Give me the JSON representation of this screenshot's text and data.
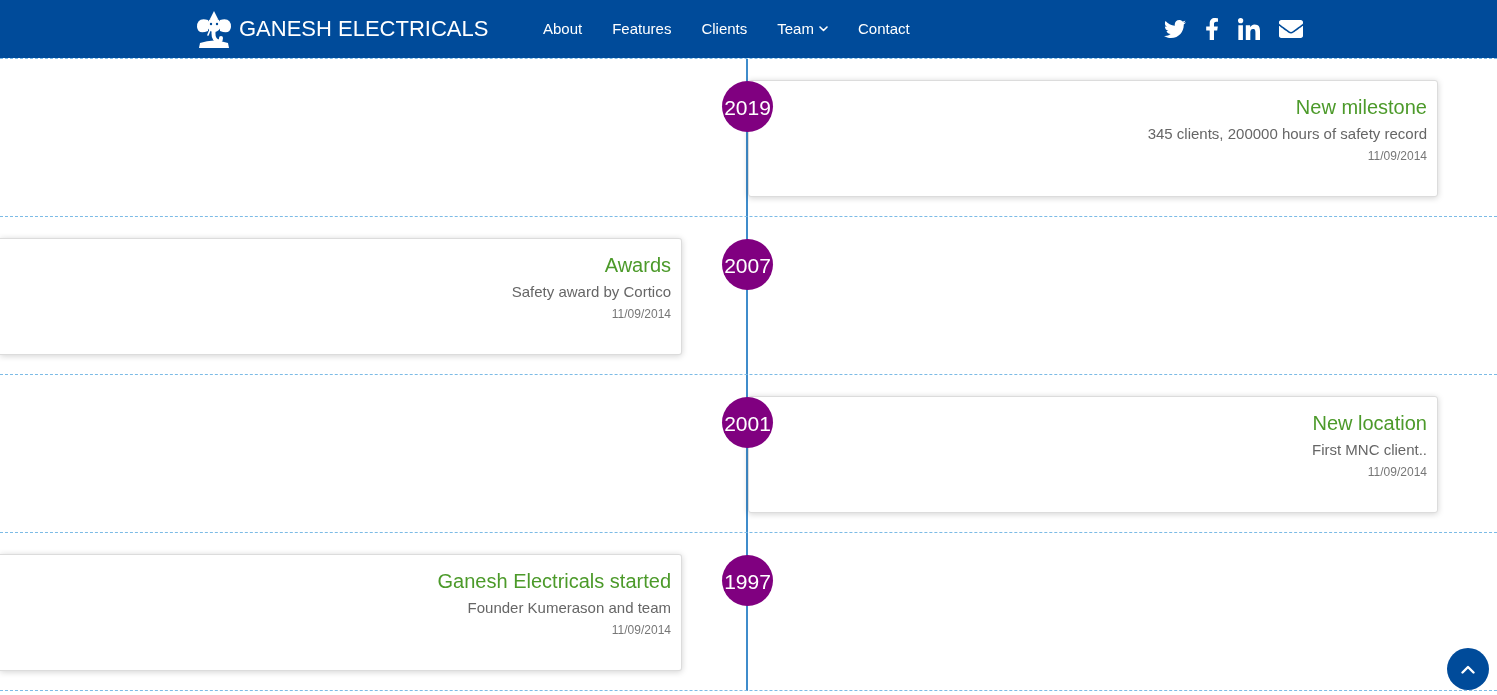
{
  "header": {
    "brand": "GANESH ELECTRICALS",
    "nav": [
      {
        "label": "About",
        "kind": "link"
      },
      {
        "label": "Features",
        "kind": "link"
      },
      {
        "label": "Clients",
        "kind": "link"
      },
      {
        "label": "Team",
        "kind": "dropdown"
      },
      {
        "label": "Contact",
        "kind": "link"
      }
    ]
  },
  "timeline": [
    {
      "year": "2019",
      "kind": "right",
      "title": "New milestone",
      "description": "345 clients, 200000 hours of safety record",
      "date": "11/09/2014"
    },
    {
      "year": "2007",
      "kind": "left",
      "title": "Awards",
      "description": "Safety award by Cortico",
      "date": "11/09/2014"
    },
    {
      "year": "2001",
      "kind": "right",
      "title": "New location",
      "description": "First MNC client..",
      "date": "11/09/2014"
    },
    {
      "year": "1997",
      "kind": "left",
      "title": "Ganesh Electricals started",
      "description": "Founder Kumerason and team",
      "date": "11/09/2014"
    }
  ]
}
